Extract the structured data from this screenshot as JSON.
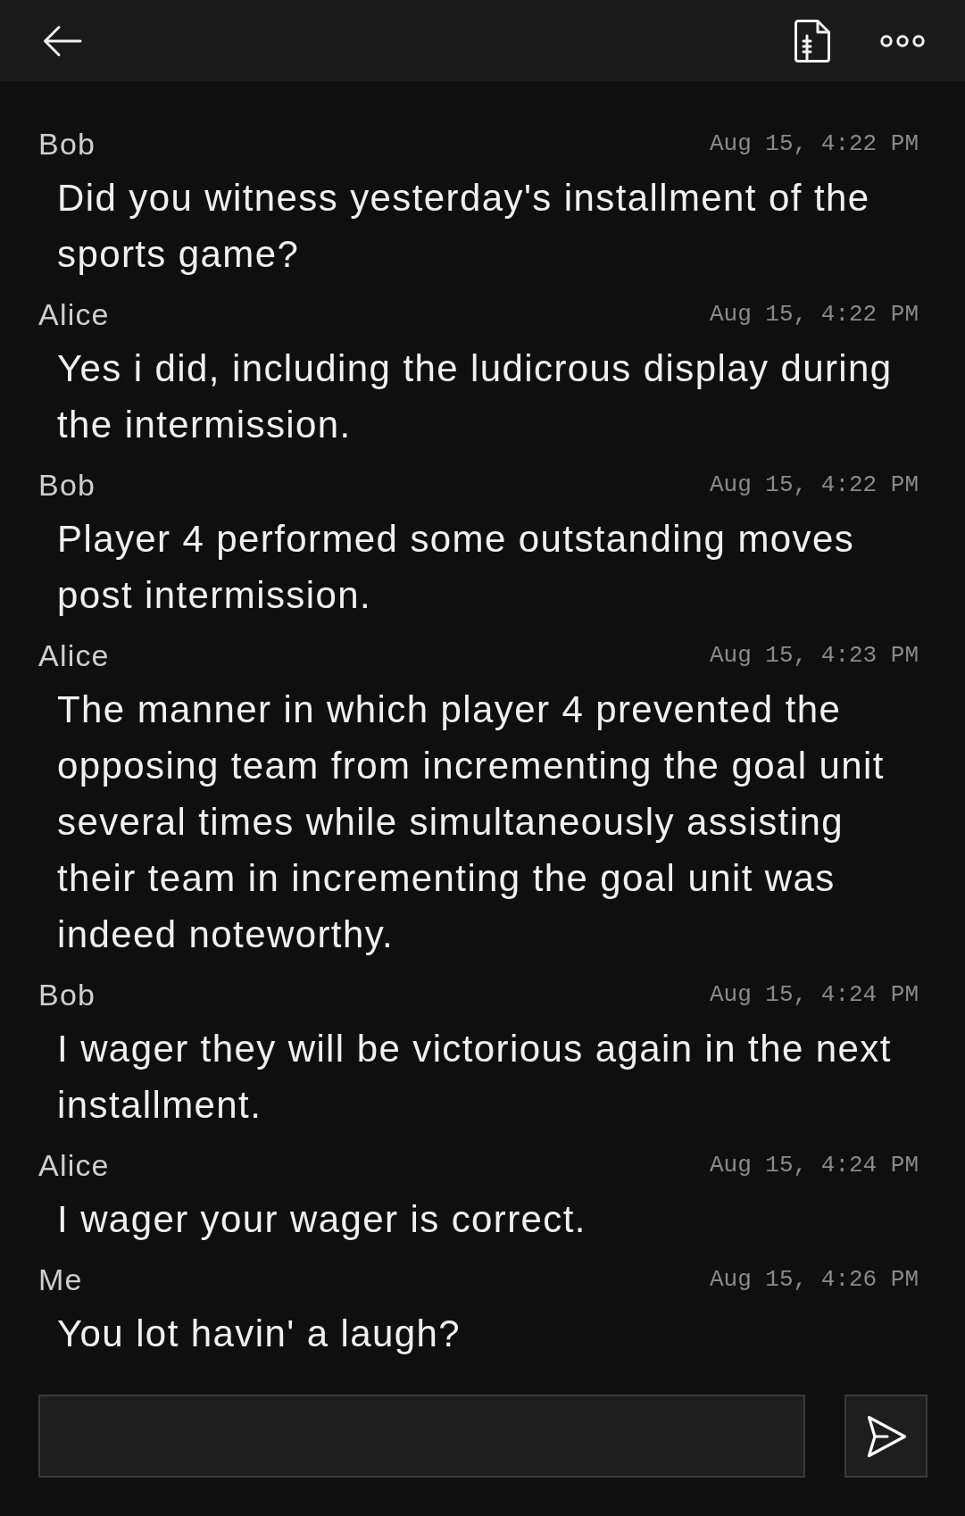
{
  "messages": [
    {
      "sender": "Bob",
      "time": "Aug 15, 4:22 PM",
      "text": "Did you witness yesterday's installment of the sports game?"
    },
    {
      "sender": "Alice",
      "time": "Aug 15, 4:22 PM",
      "text": "Yes i did, including the ludicrous display during the intermission."
    },
    {
      "sender": "Bob",
      "time": "Aug 15, 4:22 PM",
      "text": "Player 4 performed some outstanding moves post intermission."
    },
    {
      "sender": "Alice",
      "time": "Aug 15, 4:23 PM",
      "text": "The manner in which player 4 prevented the opposing team from incrementing the goal unit several times while simultaneously assisting their team in incrementing the goal unit was indeed noteworthy."
    },
    {
      "sender": "Bob",
      "time": "Aug 15, 4:24 PM",
      "text": "I wager they will be victorious again in the next installment."
    },
    {
      "sender": "Alice",
      "time": "Aug 15, 4:24 PM",
      "text": "I wager your wager is correct."
    },
    {
      "sender": "Me",
      "time": "Aug 15, 4:26 PM",
      "text": "You lot havin' a laugh?"
    }
  ]
}
